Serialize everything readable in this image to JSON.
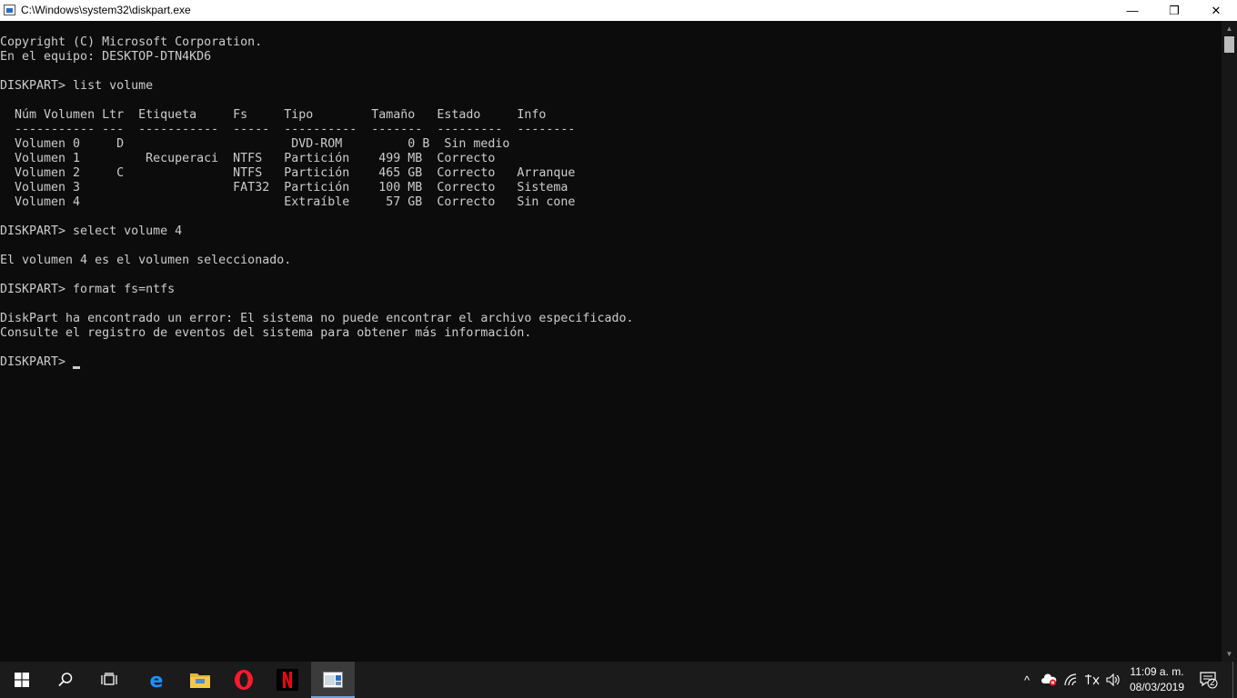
{
  "window": {
    "title": "C:\\Windows\\system32\\diskpart.exe",
    "minimize_glyph": "—",
    "maximize_glyph": "❐",
    "close_glyph": "✕"
  },
  "console": {
    "lines": [
      "Copyright (C) Microsoft Corporation.",
      "En el equipo: DESKTOP-DTN4KD6",
      "",
      "DISKPART> list volume",
      "",
      "  Núm Volumen Ltr  Etiqueta     Fs     Tipo        Tamaño   Estado     Info",
      "  ----------- ---  -----------  -----  ----------  -------  ---------  --------",
      "  Volumen 0     D                       DVD-ROM         0 B  Sin medio",
      "  Volumen 1         Recuperaci  NTFS   Partición    499 MB  Correcto",
      "  Volumen 2     C               NTFS   Partición    465 GB  Correcto   Arranque",
      "  Volumen 3                     FAT32  Partición    100 MB  Correcto   Sistema",
      "  Volumen 4                            Extraíble     57 GB  Correcto   Sin cone",
      "",
      "DISKPART> select volume 4",
      "",
      "El volumen 4 es el volumen seleccionado.",
      "",
      "DISKPART> format fs=ntfs",
      "",
      "DiskPart ha encontrado un error: El sistema no puede encontrar el archivo especificado.",
      "Consulte el registro de eventos del sistema para obtener más información.",
      "",
      "DISKPART> "
    ]
  },
  "scrollbar": {
    "up_glyph": "▲",
    "down_glyph": "▼"
  },
  "taskbar": {
    "apps": [
      {
        "name": "start",
        "icon": "windows-logo-icon"
      },
      {
        "name": "search",
        "icon": "search-icon"
      },
      {
        "name": "task-view",
        "icon": "task-view-icon"
      },
      {
        "name": "edge",
        "icon": "edge-icon",
        "color": "#1e90ff"
      },
      {
        "name": "file-explorer",
        "icon": "folder-icon",
        "color": "#f7c948"
      },
      {
        "name": "opera",
        "icon": "opera-icon",
        "color": "#ff1b2d"
      },
      {
        "name": "netflix",
        "icon": "netflix-icon",
        "color": "#e50914"
      },
      {
        "name": "diskpart",
        "icon": "console-app-icon",
        "active": true
      }
    ],
    "tray": {
      "show_hidden_glyph": "^",
      "time": "11:09 a. m.",
      "date": "08/03/2019",
      "notifications_count": "2"
    }
  },
  "colors": {
    "console_bg": "#0c0c0c",
    "console_text": "#cccccc",
    "taskbar_bg": "#1b1b1b"
  }
}
